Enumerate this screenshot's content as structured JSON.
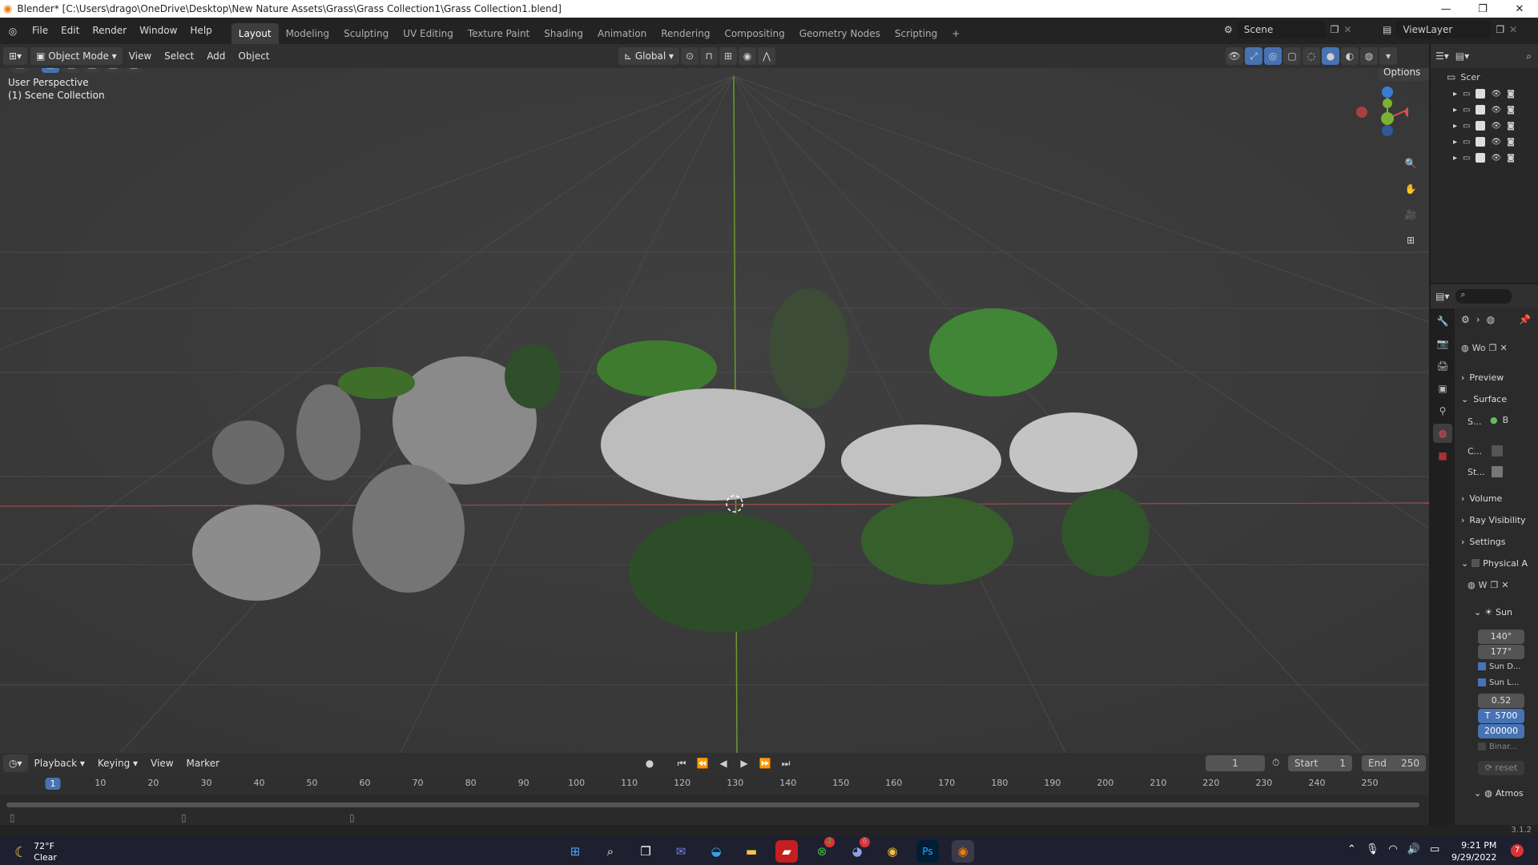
{
  "window": {
    "title": "Blender* [C:\\Users\\drago\\OneDrive\\Desktop\\New Nature Assets\\Grass\\Grass Collection1\\Grass Collection1.blend]"
  },
  "menus": [
    "File",
    "Edit",
    "Render",
    "Window",
    "Help"
  ],
  "workspaces": [
    "Layout",
    "Modeling",
    "Sculpting",
    "UV Editing",
    "Texture Paint",
    "Shading",
    "Animation",
    "Rendering",
    "Compositing",
    "Geometry Nodes",
    "Scripting"
  ],
  "active_workspace": "Layout",
  "scene": {
    "name": "Scene",
    "view_layer": "ViewLayer"
  },
  "header": {
    "mode": "Object Mode",
    "menus": [
      "View",
      "Select",
      "Add",
      "Object"
    ],
    "transform": "Global",
    "options": "Options"
  },
  "viewport": {
    "perspective": "User Perspective",
    "collection": "(1) Scene Collection"
  },
  "outliner": {
    "root": "Scer",
    "rows": 5
  },
  "properties": {
    "world_name": "Wo",
    "sections": {
      "preview": "Preview",
      "surface": "Surface",
      "volume": "Volume",
      "ray_visibility": "Ray Visibility",
      "settings": "Settings",
      "physical": "Physical A",
      "sun": "Sun",
      "atmos": "Atmos"
    },
    "surface_fields": {
      "s": "S...",
      "b": "B",
      "c": "C...",
      "st": "St..."
    },
    "world_field": "W",
    "sun_values": {
      "elev": "140°",
      "rot": "177°",
      "sun_d": "Sun D...",
      "sun_l": "Sun L...",
      "size": "0.52",
      "temp": "5700",
      "temp_prefix": "T",
      "strength": "200000",
      "binary": "Binar...",
      "reset": "reset"
    }
  },
  "timeline": {
    "menus": [
      "Playback",
      "Keying",
      "View",
      "Marker"
    ],
    "current_frame": "1",
    "start_label": "Start",
    "start": "1",
    "end_label": "End",
    "end": "250",
    "ticks": [
      "1",
      "10",
      "20",
      "30",
      "40",
      "50",
      "60",
      "70",
      "80",
      "90",
      "100",
      "110",
      "120",
      "130",
      "140",
      "150",
      "160",
      "170",
      "180",
      "190",
      "200",
      "210",
      "220",
      "230",
      "240",
      "250"
    ]
  },
  "status": {
    "version": "3.1.2"
  },
  "taskbar": {
    "temp": "72°F",
    "weather": "Clear",
    "time": "9:21 PM",
    "date": "9/29/2022",
    "notif": "7",
    "badge_xbox": "2",
    "badge_discord": "6"
  }
}
